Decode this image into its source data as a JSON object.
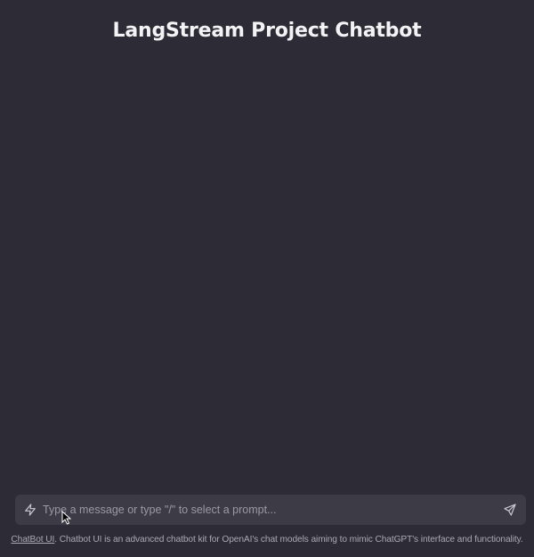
{
  "header": {
    "title": "LangStream Project Chatbot"
  },
  "composer": {
    "placeholder": "Type a message or type \"/\" to select a prompt...",
    "value": "",
    "prompt_icon": "bolt-icon",
    "send_icon": "send-icon"
  },
  "footer": {
    "link_text": "ChatBot UI",
    "text": ". Chatbot UI is an advanced chatbot kit for OpenAI's chat models aiming to mimic ChatGPT's interface and functionality."
  },
  "colors": {
    "background": "#2d2c36",
    "input_background": "#3c3b46",
    "title_text": "#f3f3f5",
    "muted_text": "#a9a8b3"
  }
}
